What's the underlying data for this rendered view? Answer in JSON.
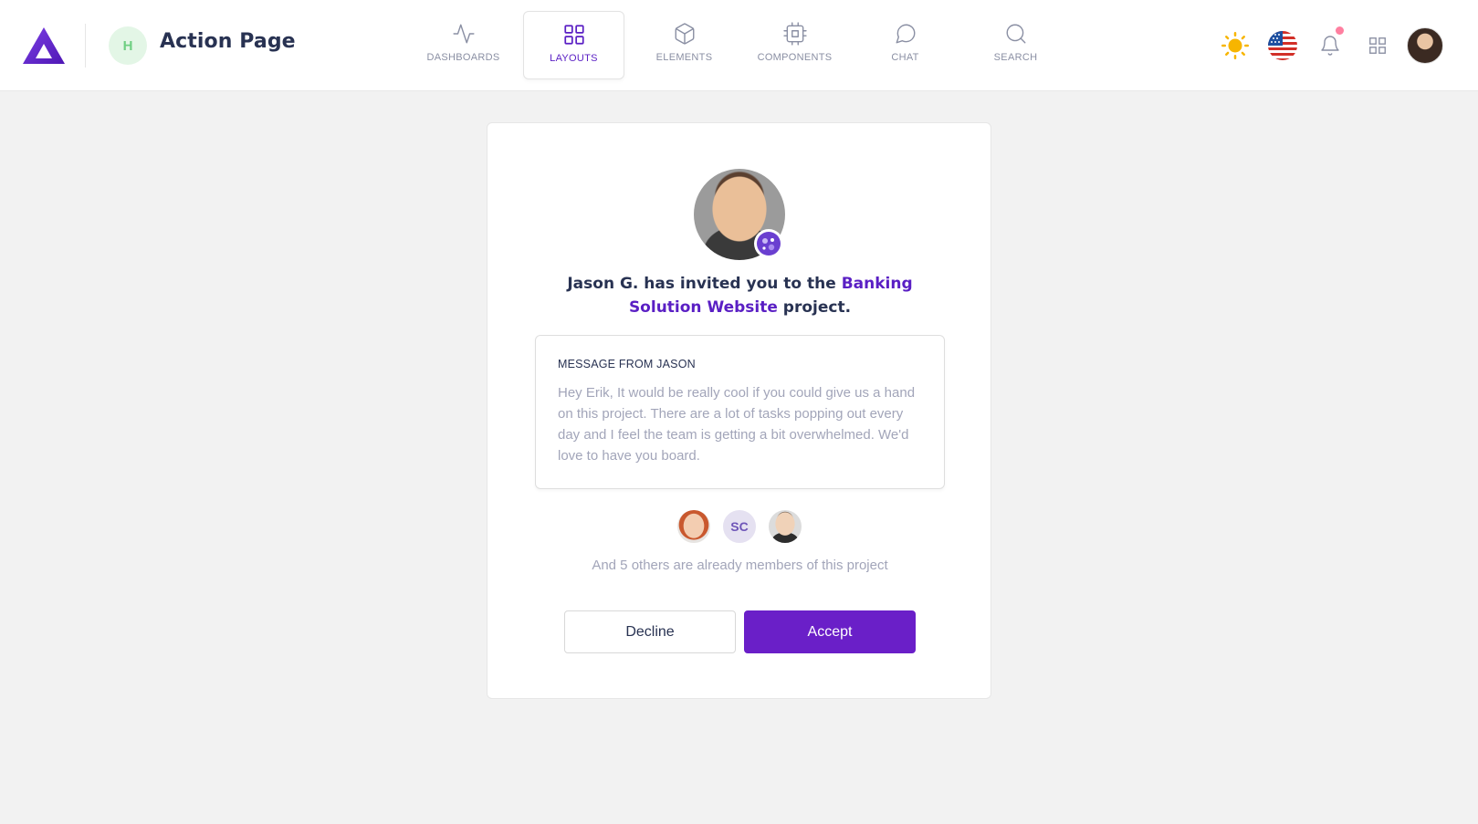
{
  "header": {
    "logo_icon": "triangle-logo-icon",
    "workspace_initial": "H",
    "page_title": "Action Page",
    "nav": [
      {
        "label": "DASHBOARDS",
        "icon": "activity-icon",
        "active": false
      },
      {
        "label": "LAYOUTS",
        "icon": "grid-icon",
        "active": true
      },
      {
        "label": "ELEMENTS",
        "icon": "box-icon",
        "active": false
      },
      {
        "label": "COMPONENTS",
        "icon": "cpu-icon",
        "active": false
      },
      {
        "label": "CHAT",
        "icon": "message-circle-icon",
        "active": false
      },
      {
        "label": "SEARCH",
        "icon": "search-icon",
        "active": false
      }
    ],
    "right_icons": [
      "sun-icon",
      "us-flag-icon",
      "bell-icon",
      "apps-grid-icon",
      "user-avatar"
    ]
  },
  "invite": {
    "text_before": "Jason G. has invited you to the ",
    "project_name": "Banking Solution Website",
    "text_after": " project.",
    "message_title": "MESSAGE FROM JASON",
    "message_body": "Hey Erik, It would be really cool if you could give us a hand on this project. There are a lot of tasks popping out every day and I feel the team is getting a bit overwhelmed. We'd love to have you board.",
    "member_initials": "SC",
    "members_text": "And 5 others are already members of this project",
    "decline_label": "Decline",
    "accept_label": "Accept"
  },
  "colors": {
    "accent": "#6a1fc8",
    "link": "#5a1fc4",
    "heading": "#283252",
    "muted": "#a2a5b9",
    "background": "#f2f2f2"
  }
}
